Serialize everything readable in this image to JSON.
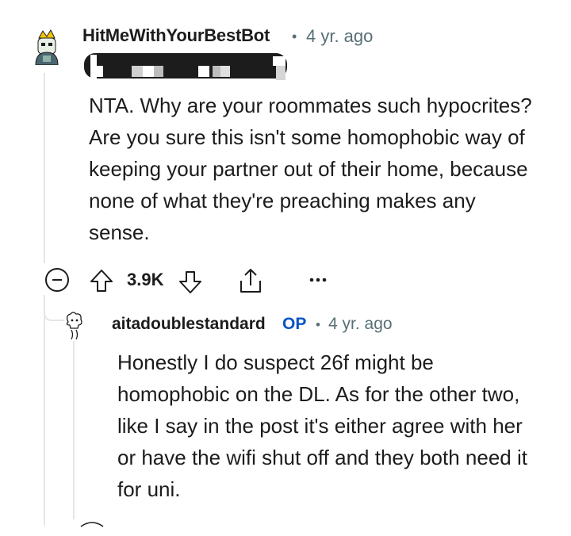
{
  "comment": {
    "username": "HitMeWithYourBestBot",
    "separator": "•",
    "timestamp": "4 yr. ago",
    "body": "NTA. Why are your roommates such hypocrites? Are you sure this isn't some homophobic way of keeping your partner out of their home, because none of what they're preaching makes any sense.",
    "score": "3.9K",
    "icons": [
      "collapse-icon",
      "upvote-icon",
      "downvote-icon",
      "share-icon",
      "more-icon"
    ]
  },
  "reply": {
    "username": "aitadoublestandard",
    "op_badge": "OP",
    "separator": "•",
    "timestamp": "4 yr. ago",
    "body": "Honestly I do suspect 26f might be homophobic on the DL. As for the other two, like I say in the post it's either agree with her or have the wifi shut off and they both need it for uni."
  },
  "colors": {
    "text": "#1c1c1c",
    "meta": "#576f76",
    "op": "#0a54c4",
    "thread_line": "#e5e6e8"
  }
}
